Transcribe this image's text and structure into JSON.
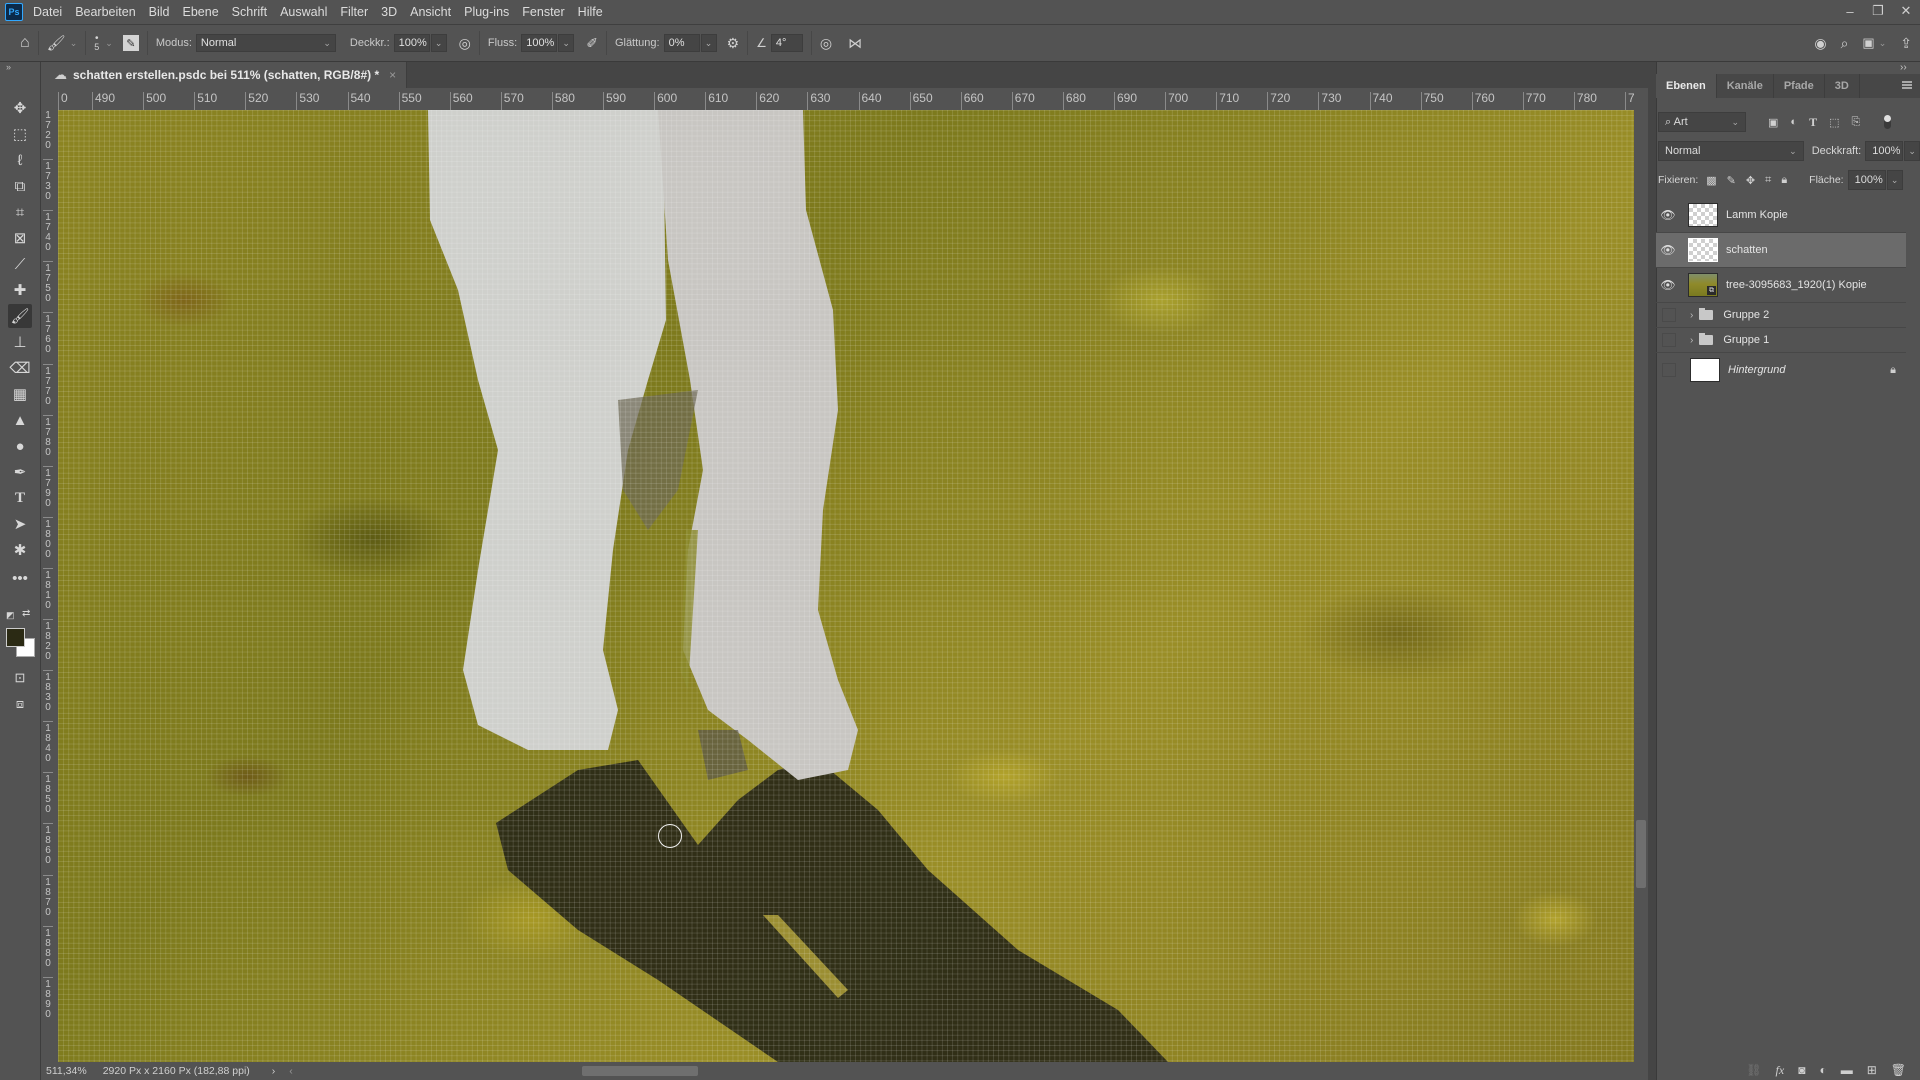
{
  "app": {
    "logo": "Ps"
  },
  "menu": [
    "Datei",
    "Bearbeiten",
    "Bild",
    "Ebene",
    "Schrift",
    "Auswahl",
    "Filter",
    "3D",
    "Ansicht",
    "Plug-ins",
    "Fenster",
    "Hilfe"
  ],
  "window_controls": {
    "minimize": "–",
    "restore": "❐",
    "close": "✕"
  },
  "options": {
    "brush_size": "5",
    "mode_label": "Modus:",
    "mode_value": "Normal",
    "opacity_label": "Deckkr.:",
    "opacity_value": "100%",
    "flow_label": "Fluss:",
    "flow_value": "100%",
    "smoothing_label": "Glättung:",
    "smoothing_value": "0%",
    "angle_value": "4°"
  },
  "document": {
    "tab_title": "schatten erstellen.psdc bei 511% (schatten, RGB/8#) *",
    "close": "×"
  },
  "rulers": {
    "horizontal": [
      "0",
      "490",
      "500",
      "510",
      "520",
      "530",
      "540",
      "550",
      "560",
      "570",
      "580",
      "590",
      "600",
      "610",
      "620",
      "630",
      "640",
      "650",
      "660",
      "670",
      "680",
      "690",
      "700",
      "710",
      "720",
      "730",
      "740",
      "750",
      "760",
      "770",
      "780",
      "7"
    ],
    "vertical": [
      "1720",
      "1730",
      "1740",
      "1750",
      "1760",
      "1770",
      "1780",
      "1790",
      "1800",
      "1810",
      "1820",
      "1830",
      "1840",
      "1850",
      "1860",
      "1870",
      "1880",
      "1890"
    ]
  },
  "status": {
    "zoom": "511,34%",
    "doc_info": "2920 Px x 2160 Px (182,88 ppi)",
    "arrow": "›"
  },
  "colors": {
    "foreground": "#2b2a14",
    "background": "#ffffff",
    "accent": "#31a8ff"
  },
  "panel": {
    "tabs": [
      "Ebenen",
      "Kanäle",
      "Pfade",
      "3D"
    ],
    "active_tab": "Ebenen",
    "filter_value": "Art",
    "blend_mode": "Normal",
    "opacity_label": "Deckkraft:",
    "opacity_value": "100%",
    "lock_label": "Fixieren:",
    "fill_label": "Fläche:",
    "fill_value": "100%",
    "layers": [
      {
        "name": "Lamm Kopie",
        "visible": true,
        "type": "pixel"
      },
      {
        "name": "schatten",
        "visible": true,
        "type": "pixel",
        "selected": true
      },
      {
        "name": "tree-3095683_1920(1) Kopie",
        "visible": true,
        "type": "smart"
      },
      {
        "name": "Gruppe 2",
        "visible": false,
        "type": "group"
      },
      {
        "name": "Gruppe 1",
        "visible": false,
        "type": "group"
      },
      {
        "name": "Hintergrund",
        "visible": false,
        "type": "background",
        "locked": true
      }
    ]
  }
}
